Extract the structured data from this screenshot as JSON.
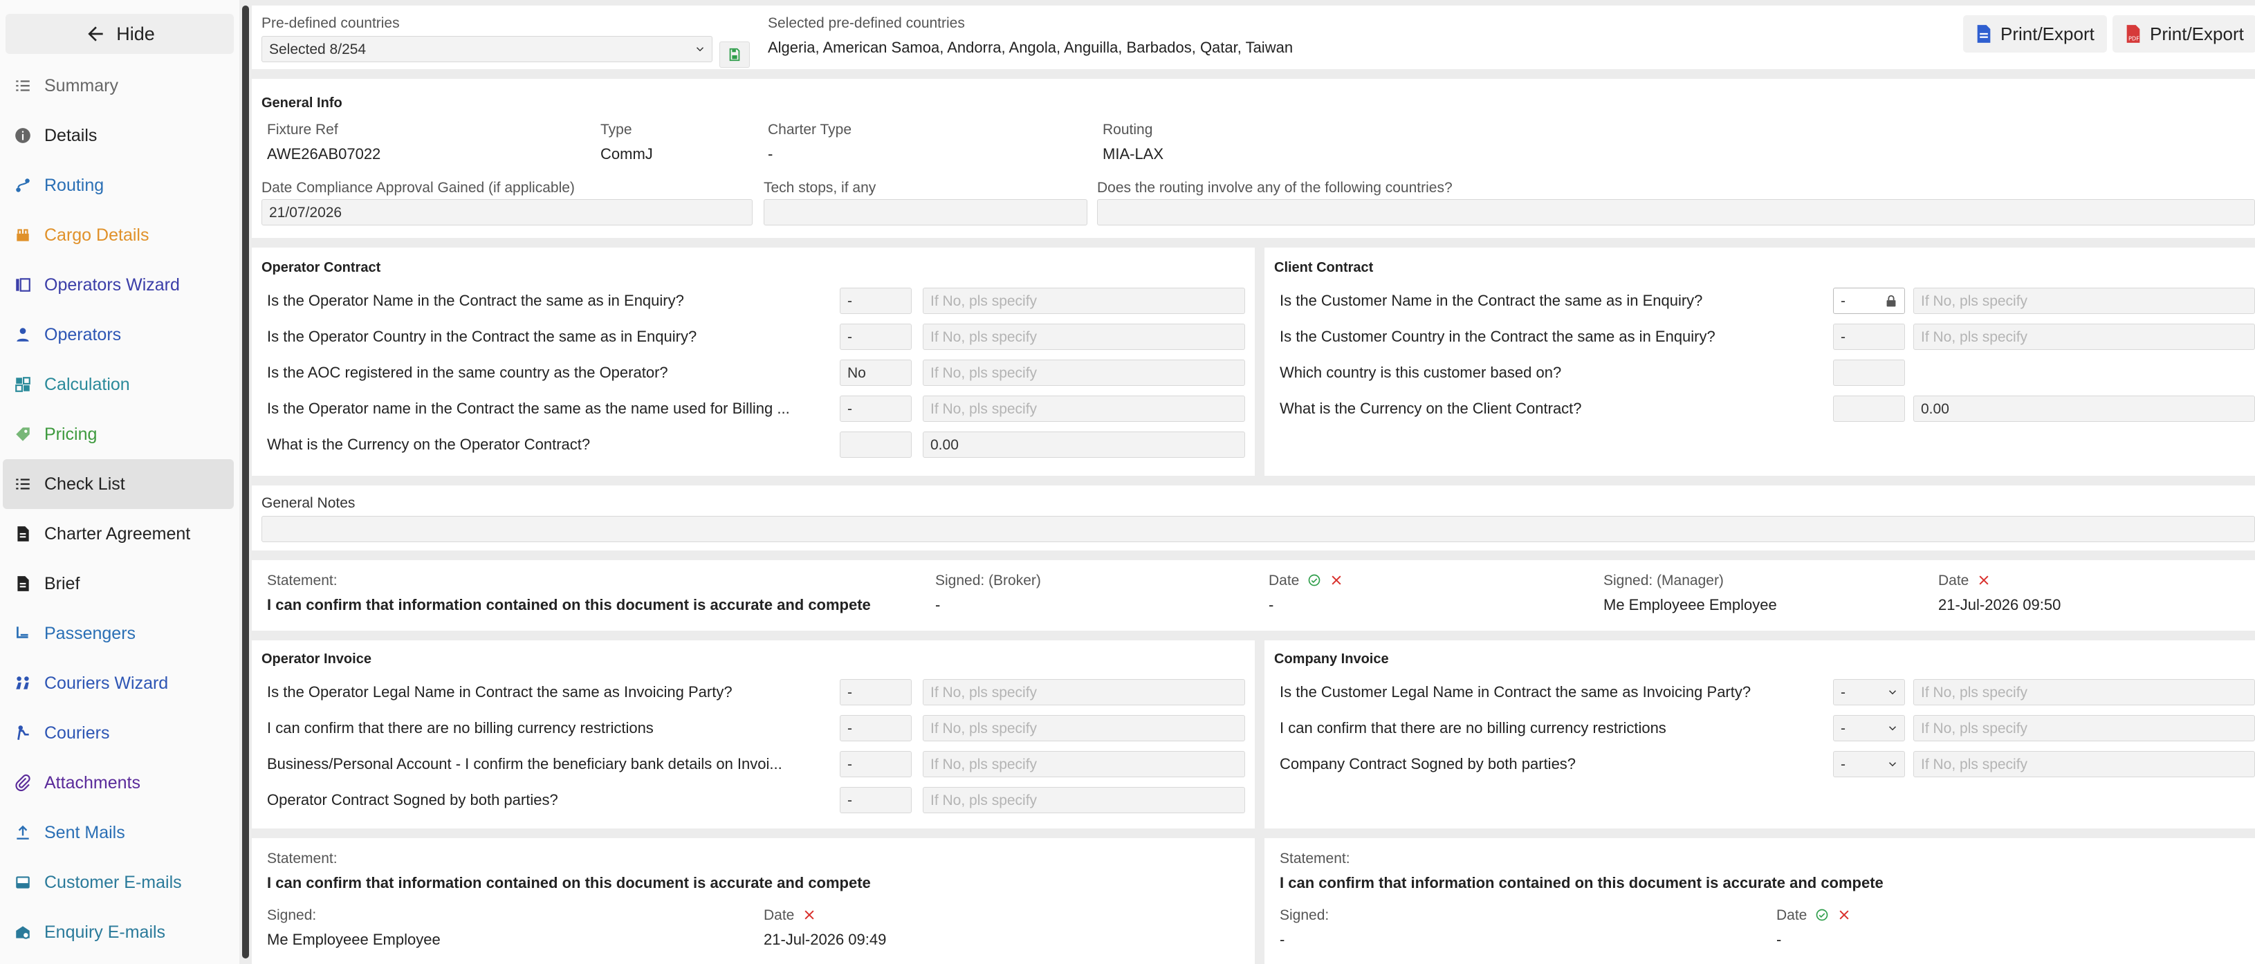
{
  "sidebar": {
    "hide_label": "Hide",
    "items": [
      {
        "label": "Summary",
        "icon": "checklist-icon",
        "color": "#666666"
      },
      {
        "label": "Details",
        "icon": "info-icon",
        "color": "#222222"
      },
      {
        "label": "Routing",
        "icon": "route-icon",
        "color": "#2a6fb5"
      },
      {
        "label": "Cargo Details",
        "icon": "cargo-icon",
        "color": "#e0912a"
      },
      {
        "label": "Operators Wizard",
        "icon": "wizard-icon",
        "color": "#3b3ea8"
      },
      {
        "label": "Operators",
        "icon": "operator-icon",
        "color": "#2d55b4"
      },
      {
        "label": "Calculation",
        "icon": "calculation-icon",
        "color": "#2a8a9a"
      },
      {
        "label": "Pricing",
        "icon": "tag-icon",
        "color": "#3e9a3e"
      },
      {
        "label": "Check List",
        "icon": "checklist-icon",
        "color": "#222222"
      },
      {
        "label": "Charter Agreement",
        "icon": "document-icon",
        "color": "#222222"
      },
      {
        "label": "Brief",
        "icon": "document-icon",
        "color": "#222222"
      },
      {
        "label": "Passengers",
        "icon": "passenger-icon",
        "color": "#2a6fb5"
      },
      {
        "label": "Couriers Wizard",
        "icon": "courier-wizard-icon",
        "color": "#2d55b4"
      },
      {
        "label": "Couriers",
        "icon": "courier-icon",
        "color": "#2d55b4"
      },
      {
        "label": "Attachments",
        "icon": "attachment-icon",
        "color": "#5a2a9a"
      },
      {
        "label": "Sent Mails",
        "icon": "upload-icon",
        "color": "#2a6fb5"
      },
      {
        "label": "Customer E-mails",
        "icon": "inbox-icon",
        "color": "#2a7a9a"
      },
      {
        "label": "Enquiry E-mails",
        "icon": "enquiry-mail-icon",
        "color": "#2a7a9a"
      }
    ]
  },
  "header": {
    "predefined_label": "Pre-defined countries",
    "predefined_value": "Selected 8/254",
    "selected_label": "Selected pre-defined countries",
    "selected_value": "Algeria, American Samoa, Andorra, Angola, Anguilla, Barbados, Qatar, Taiwan",
    "print_btn_1": "Print/Export",
    "print_btn_2": "Print/Export"
  },
  "general_info": {
    "title": "General Info",
    "fixture_ref_label": "Fixture Ref",
    "fixture_ref_value": "AWE26AB07022",
    "type_label": "Type",
    "type_value": "CommJ",
    "charter_type_label": "Charter Type",
    "charter_type_value": "-",
    "routing_label": "Routing",
    "routing_value": "MIA-LAX",
    "date_compliance_label": "Date Compliance Approval Gained (if applicable)",
    "date_compliance_value": "21/07/2026",
    "tech_stops_label": "Tech stops, if any",
    "routing_countries_label": "Does the routing involve any of the following countries?"
  },
  "placeholder": "If No, pls specify",
  "operator_contract": {
    "title": "Operator Contract",
    "rows": [
      {
        "q": "Is the Operator Name in the Contract the same as in Enquiry?",
        "v": "-",
        "spec": ""
      },
      {
        "q": "Is the Operator Country in the Contract the same as in Enquiry?",
        "v": "-",
        "spec": ""
      },
      {
        "q": "Is the AOC registered in the same country as the Operator?",
        "v": "No",
        "spec": ""
      },
      {
        "q": "Is the Operator name in the Contract the same as the name used for Billing ...",
        "v": "-",
        "spec": ""
      },
      {
        "q": "What is the Currency on the Operator Contract?",
        "v": "",
        "spec": "0.00"
      }
    ]
  },
  "client_contract": {
    "title": "Client Contract",
    "rows": [
      {
        "q": "Is the Customer Name in the Contract the same as in Enquiry?",
        "v": "-",
        "spec": ""
      },
      {
        "q": "Is the Customer Country in the Contract the same as in Enquiry?",
        "v": "-",
        "spec": ""
      },
      {
        "q": "Which country is this customer based on?",
        "v": "",
        "spec": ""
      },
      {
        "q": "What is the Currency on the Client Contract?",
        "v": "",
        "spec": "0.00"
      }
    ]
  },
  "general_notes": {
    "label": "General Notes"
  },
  "statement_1": {
    "statement_label": "Statement:",
    "statement_text": "I can confirm that information contained on this document is accurate and compete",
    "signed_broker_label": "Signed: (Broker)",
    "signed_broker_value": "-",
    "date1_label": "Date",
    "date1_value": "-",
    "signed_manager_label": "Signed: (Manager)",
    "signed_manager_value": "Me Employeee Employee",
    "date2_label": "Date",
    "date2_value": "21-Jul-2026 09:50"
  },
  "operator_invoice": {
    "title": "Operator Invoice",
    "rows": [
      {
        "q": "Is the Operator Legal Name in Contract the same as Invoicing Party?",
        "v": "-"
      },
      {
        "q": "I can confirm that there are no billing currency restrictions",
        "v": "-"
      },
      {
        "q": "Business/Personal Account - I confirm the beneficiary bank details on Invoi...",
        "v": "-"
      },
      {
        "q": "Operator Contract Sogned by both parties?",
        "v": "-"
      }
    ]
  },
  "company_invoice": {
    "title": "Company Invoice",
    "rows": [
      {
        "q": "Is the Customer Legal Name in Contract the same as Invoicing Party?",
        "v": "-"
      },
      {
        "q": "I can confirm that there are no billing currency restrictions",
        "v": "-"
      },
      {
        "q": "Company Contract Sogned by both parties?",
        "v": "-"
      }
    ]
  },
  "statement_2": {
    "statement_label": "Statement:",
    "statement_text": "I can confirm that information contained on this document is accurate and compete",
    "signed_label": "Signed:",
    "signed_value": "Me Employeee Employee",
    "date_label": "Date",
    "date_value": "21-Jul-2026 09:49"
  },
  "statement_3": {
    "statement_label": "Statement:",
    "statement_text": "I can confirm that information contained on this document is accurate and compete",
    "signed_label": "Signed:",
    "signed_value": "-",
    "date_label": "Date",
    "date_value": "-"
  },
  "colors": {
    "accent_green": "#2e9d4a",
    "danger_red": "#d9302c",
    "pdf_red": "#d63a3a",
    "doc_blue": "#2f5fd0"
  }
}
